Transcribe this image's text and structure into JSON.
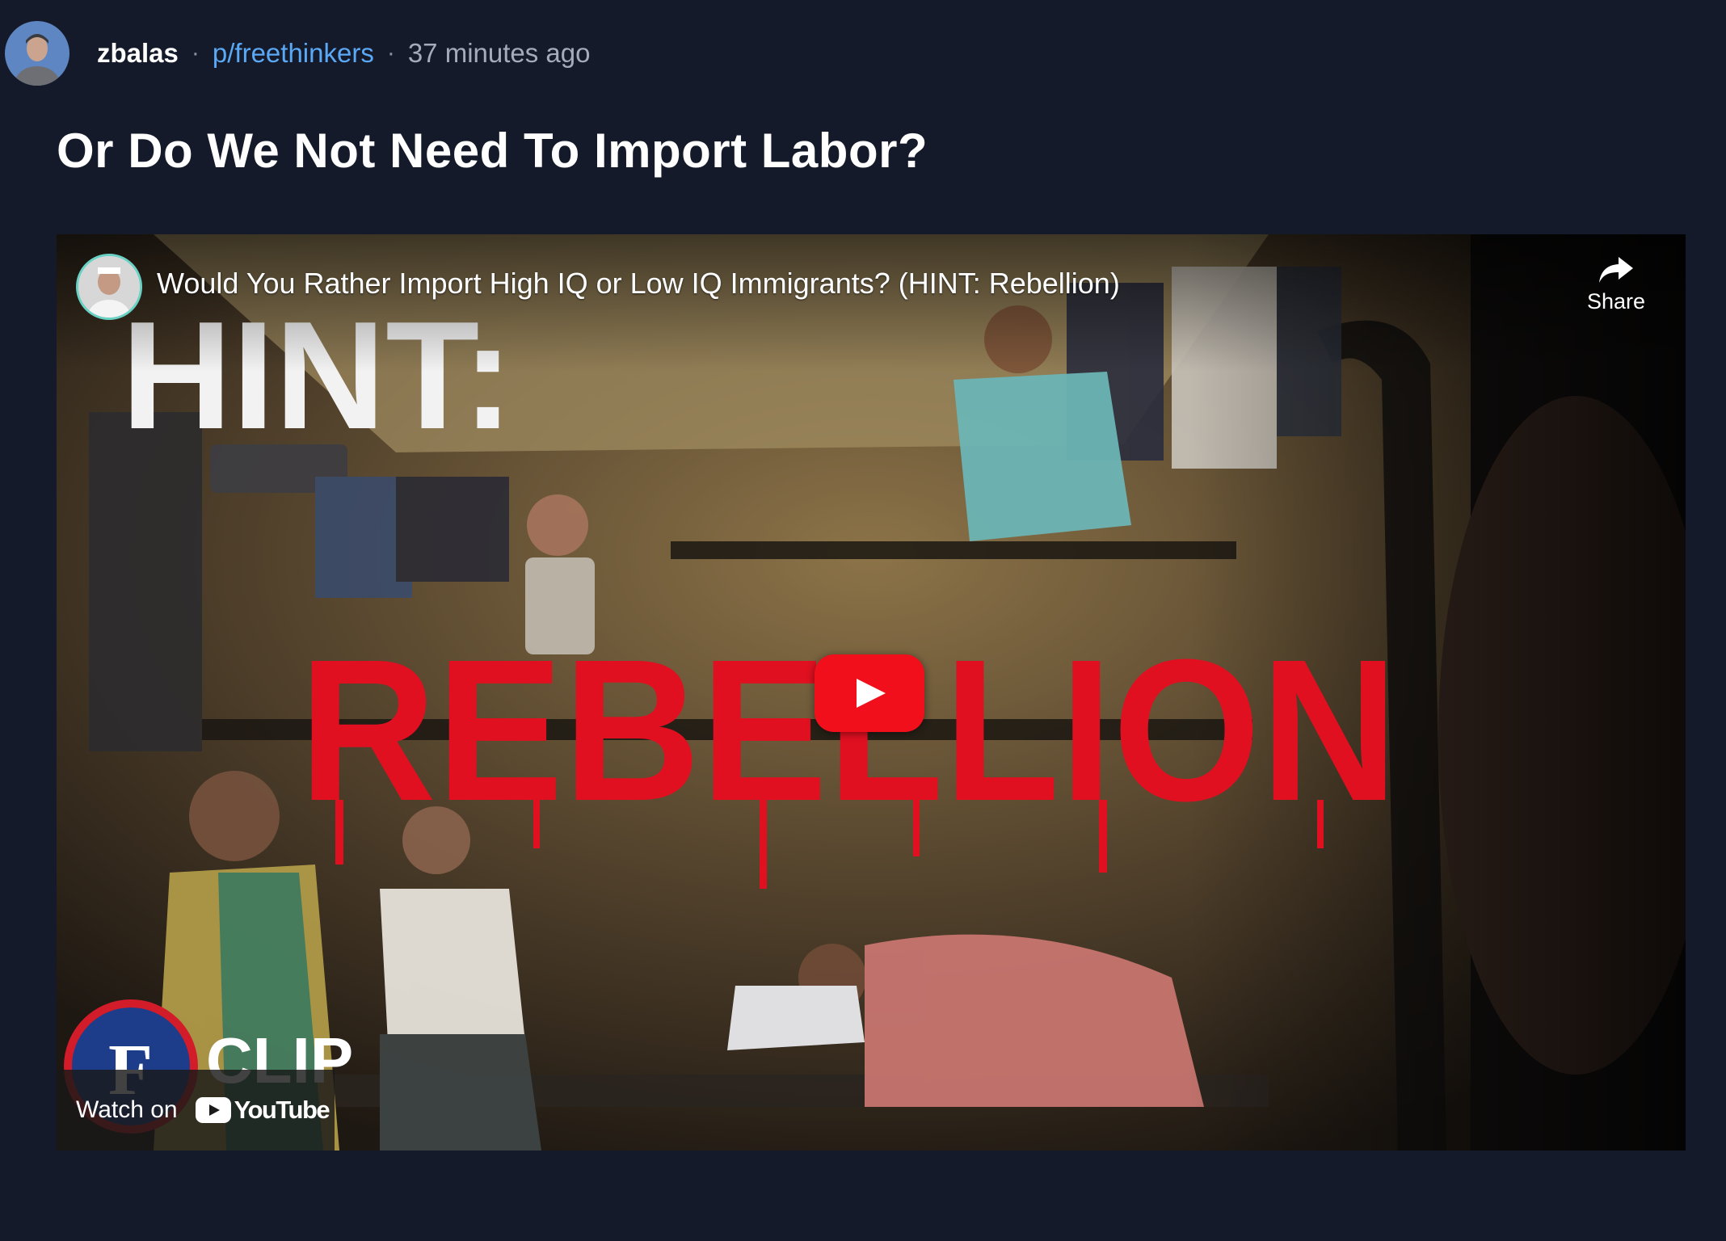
{
  "post": {
    "author": "zbalas",
    "separator": "·",
    "community": "p/freethinkers",
    "timestamp": "37 minutes ago",
    "title": "Or Do We Not Need To Import Labor?"
  },
  "video": {
    "title": "Would You Rather Import High IQ or Low IQ Immigrants? (HINT: Rebellion)",
    "share_label": "Share",
    "watch_on_label": "Watch on",
    "youtube_wordmark": "YouTube",
    "thumbnail_text_top": "HINT:",
    "thumbnail_text_main": "REBELLION",
    "thumbnail_badge_text": "CLIP",
    "thumbnail_badge_letter": "F"
  },
  "colors": {
    "background": "#141a2a",
    "link": "#5ba8f5",
    "play_button": "#f00f1a",
    "thumbnail_text_red": "#e01020"
  }
}
